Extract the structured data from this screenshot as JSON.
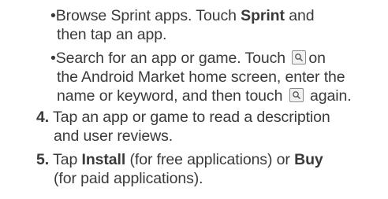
{
  "bullets": [
    {
      "marker": "•",
      "line1_pre": "Browse Sprint apps. Touch ",
      "line1_bold": "Sprint",
      "line1_post": " and",
      "line2": "then tap an app."
    },
    {
      "marker": "•",
      "line1_pre": "Search for an app or game. Touch",
      "line2_pre": "the Android Market home screen, enter the",
      "line1_post": "on",
      "line3_pre": "name or keyword, and then touch",
      "line3_post": "again."
    }
  ],
  "steps": [
    {
      "number": "4.",
      "line1": "Tap an app or game to read a description",
      "line2": "and user reviews."
    },
    {
      "number": "5.",
      "line1_pre": "Tap ",
      "line1_bold1": "Install",
      "line1_mid": " (for free applications) or ",
      "line1_bold2": "Buy",
      "line2": "(for paid applications)."
    }
  ],
  "icons": {
    "search_key": "search-icon"
  }
}
